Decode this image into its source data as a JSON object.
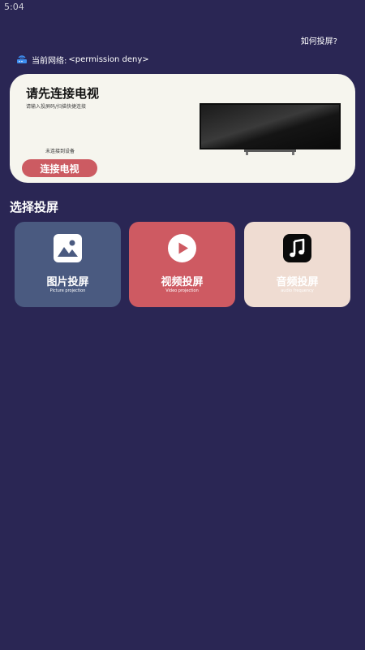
{
  "status_bar": {
    "time": "5:04"
  },
  "header": {
    "help_link": "如何投屏?"
  },
  "network": {
    "label": "当前网络:",
    "value": "<permission deny>",
    "icon": "router-icon"
  },
  "connect_card": {
    "title": "请先连接电视",
    "subtitle": "请输入投屏码/扫描快捷连接",
    "status": "未连接到设备",
    "button_label": "连接电视",
    "image": "tv-image"
  },
  "section": {
    "title": "选择投屏"
  },
  "modes": [
    {
      "label": "图片投屏",
      "sub": "Picture projection",
      "icon": "image-icon",
      "color": "#4a5a80"
    },
    {
      "label": "视频投屏",
      "sub": "Video projection",
      "icon": "play-icon",
      "color": "#ce5a62"
    },
    {
      "label": "音频投屏",
      "sub": "audio frequency",
      "icon": "music-icon",
      "color": "#efdcd2"
    }
  ]
}
